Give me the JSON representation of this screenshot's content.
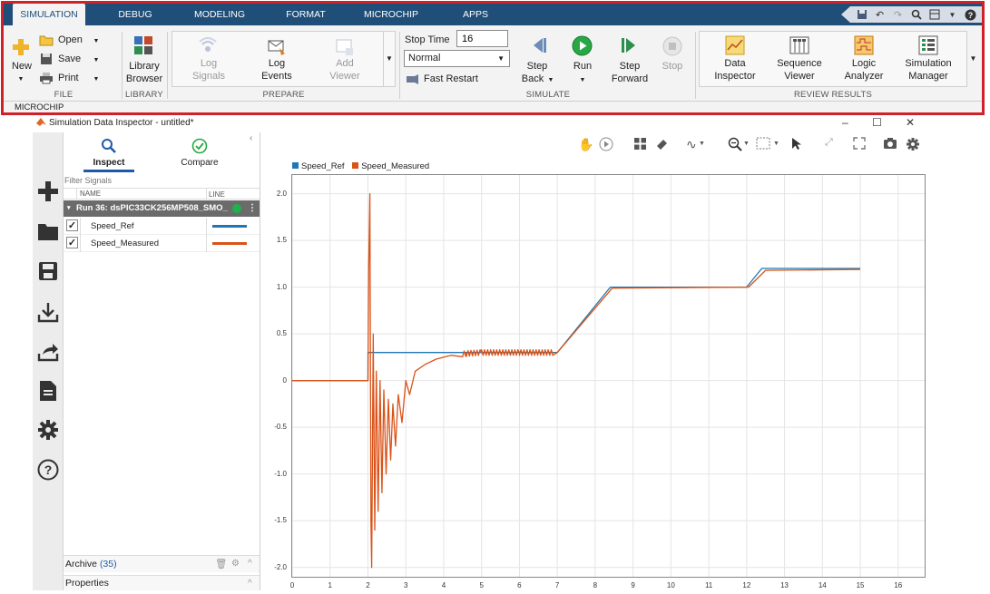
{
  "ribbon": {
    "tabs": [
      "SIMULATION",
      "DEBUG",
      "MODELING",
      "FORMAT",
      "MICROCHIP",
      "APPS"
    ],
    "file": {
      "new": "New",
      "open": "Open",
      "save": "Save",
      "print": "Print",
      "section": "FILE"
    },
    "library": {
      "label_1": "Library",
      "label_2": "Browser",
      "section": "LIBRARY"
    },
    "prepare": {
      "log_signals_1": "Log",
      "log_signals_2": "Signals",
      "log_events_1": "Log",
      "log_events_2": "Events",
      "add_viewer_1": "Add",
      "add_viewer_2": "Viewer",
      "section": "PREPARE"
    },
    "simulate": {
      "stop_time_label": "Stop Time",
      "stop_time_value": "16",
      "mode_value": "Normal",
      "fast_restart": "Fast Restart",
      "step_back_1": "Step",
      "step_back_2": "Back",
      "run": "Run",
      "step_forward_1": "Step",
      "step_forward_2": "Forward",
      "stop": "Stop",
      "section": "SIMULATE"
    },
    "review": {
      "data_inspector_1": "Data",
      "data_inspector_2": "Inspector",
      "sequence_viewer_1": "Sequence",
      "sequence_viewer_2": "Viewer",
      "logic_analyzer_1": "Logic",
      "logic_analyzer_2": "Analyzer",
      "simulation_manager_1": "Simulation",
      "simulation_manager_2": "Manager",
      "section": "REVIEW RESULTS"
    },
    "toolstrip_label": "MICROCHIP"
  },
  "app": {
    "title": "Simulation Data Inspector - untitled*"
  },
  "panel": {
    "inspect": "Inspect",
    "compare": "Compare",
    "filter_placeholder": "Filter Signals",
    "col_name": "NAME",
    "col_line": "LINE",
    "run_label": "Run 36: dsPIC33CK256MP508_SMO_",
    "archive_label": "Archive",
    "archive_count": "(35)",
    "properties": "Properties"
  },
  "colors": {
    "tab_bar": "#1f4e79",
    "ribbon_highlight": "#d0202a",
    "speed_ref": "#1f77b4",
    "speed_measured": "#d95319",
    "run_indicator": "#1bb34a"
  },
  "chart_data": {
    "type": "line",
    "x_ticks": [
      "0",
      "1",
      "2",
      "3",
      "4",
      "5",
      "6",
      "7",
      "8",
      "9",
      "10",
      "11",
      "12",
      "13",
      "14",
      "15",
      "16"
    ],
    "y_ticks": [
      "2.0",
      "1.5",
      "1.0",
      "0.5",
      "0",
      "-0.5",
      "-1.0",
      "-1.5",
      "-2.0"
    ],
    "xlim": [
      0,
      16.7
    ],
    "ylim": [
      -2.1,
      2.2
    ],
    "grid": true,
    "legend_position": "top-left",
    "series": [
      {
        "name": "Speed_Ref",
        "color": "#1f77b4",
        "points": [
          [
            0,
            0
          ],
          [
            2,
            0
          ],
          [
            2,
            0.3
          ],
          [
            7,
            0.3
          ],
          [
            8.4,
            1.0
          ],
          [
            12,
            1.0
          ],
          [
            12.4,
            1.2
          ],
          [
            15,
            1.2
          ]
        ]
      },
      {
        "name": "Speed_Measured",
        "color": "#d95319",
        "points": [
          [
            0,
            0
          ],
          [
            2,
            0
          ],
          [
            2.02,
            1.2
          ],
          [
            2.05,
            2.0
          ],
          [
            2.08,
            -1.5
          ],
          [
            2.1,
            -2.0
          ],
          [
            2.14,
            0.5
          ],
          [
            2.18,
            -1.6
          ],
          [
            2.22,
            0.1
          ],
          [
            2.27,
            -1.4
          ],
          [
            2.32,
            0.0
          ],
          [
            2.37,
            -1.2
          ],
          [
            2.42,
            -0.1
          ],
          [
            2.48,
            -1.0
          ],
          [
            2.54,
            -0.2
          ],
          [
            2.6,
            -0.85
          ],
          [
            2.66,
            -0.25
          ],
          [
            2.73,
            -0.7
          ],
          [
            2.8,
            -0.15
          ],
          [
            2.9,
            -0.45
          ],
          [
            3.0,
            0.0
          ],
          [
            3.1,
            -0.15
          ],
          [
            3.25,
            0.1
          ],
          [
            3.5,
            0.17
          ],
          [
            3.8,
            0.23
          ],
          [
            4.2,
            0.27
          ],
          [
            4.6,
            0.29
          ],
          [
            5.0,
            0.3
          ],
          [
            6.0,
            0.3
          ],
          [
            7.0,
            0.3
          ],
          [
            8.45,
            0.99
          ],
          [
            12.05,
            1.0
          ],
          [
            12.5,
            1.18
          ],
          [
            15,
            1.19
          ]
        ],
        "ripple": {
          "x_from": 4.5,
          "x_to": 6.9,
          "amplitude": 0.03,
          "period": 0.08
        }
      }
    ]
  }
}
